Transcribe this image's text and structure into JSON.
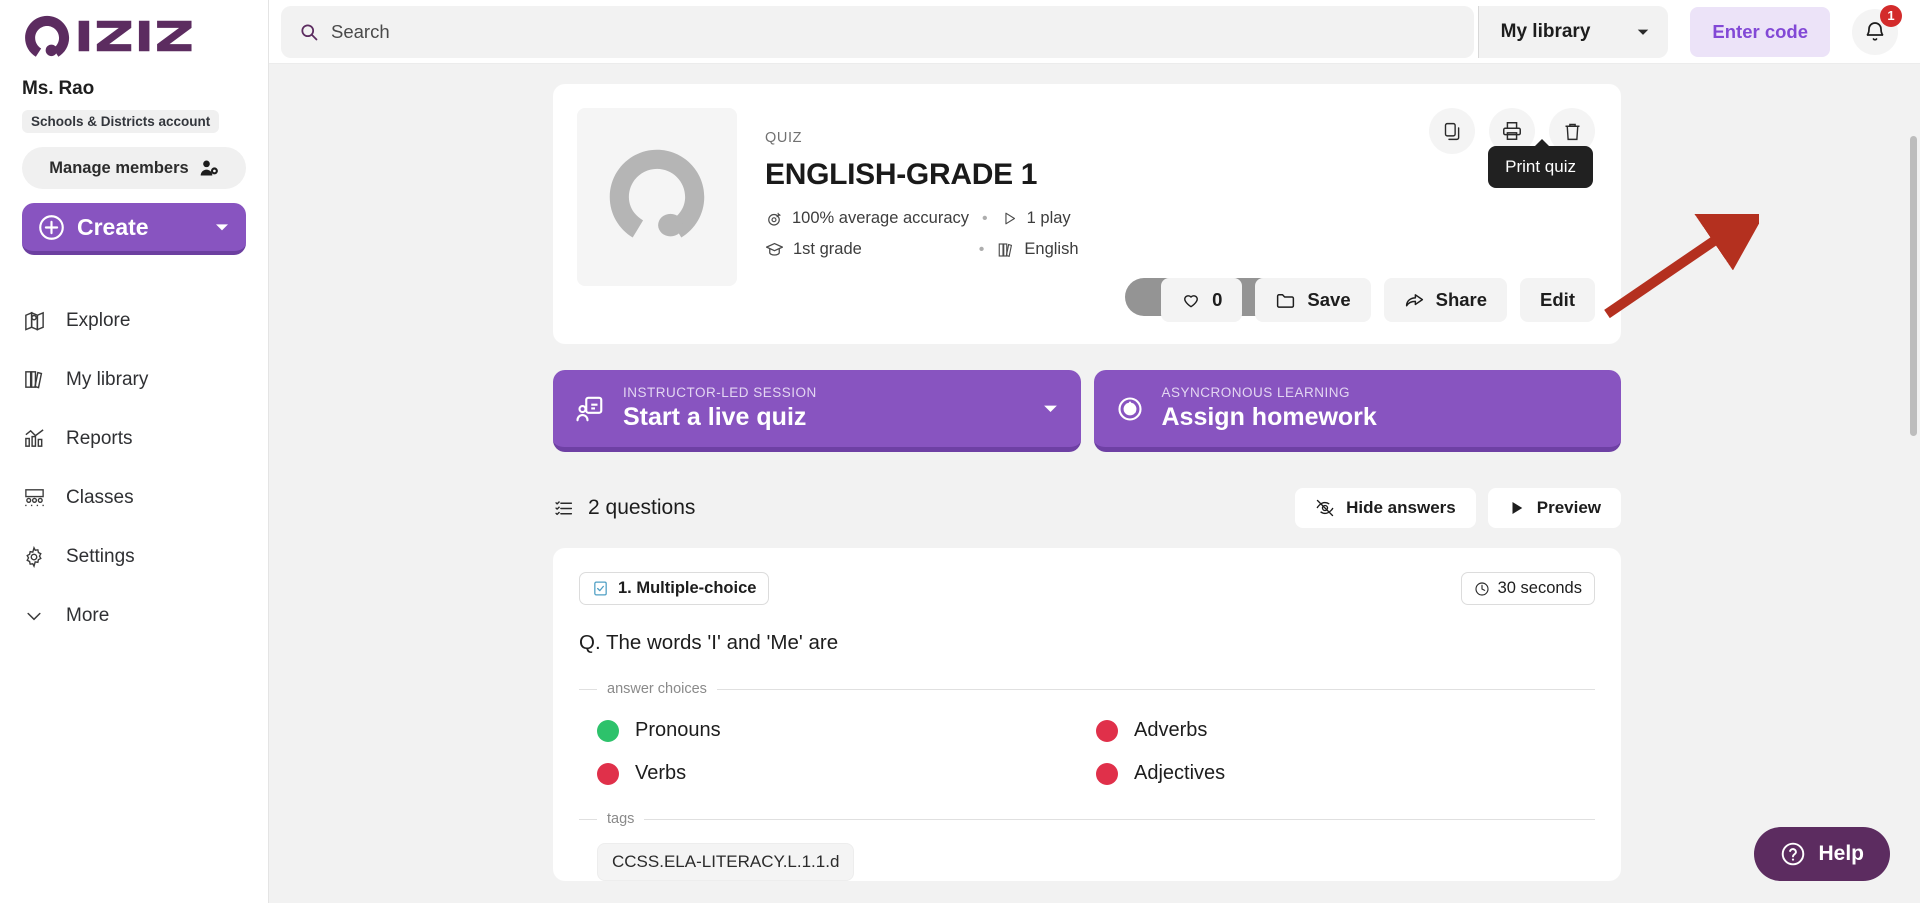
{
  "brand": {
    "name": "Quizizz",
    "purple": "#8854c0",
    "logo_dark": "#5c2c60"
  },
  "sidebar": {
    "user_name": "Ms. Rao",
    "account_badge": "Schools & Districts account",
    "manage_members_label": "Manage members",
    "create_label": "Create",
    "items": [
      {
        "label": "Explore",
        "icon": "compass-map-icon"
      },
      {
        "label": "My library",
        "icon": "books-icon"
      },
      {
        "label": "Reports",
        "icon": "bar-chart-icon"
      },
      {
        "label": "Classes",
        "icon": "people-group-icon"
      },
      {
        "label": "Settings",
        "icon": "gear-icon"
      },
      {
        "label": "More",
        "icon": "chevron-down-icon"
      }
    ]
  },
  "topbar": {
    "search_placeholder": "Search",
    "library_selected": "My library",
    "enter_code_label": "Enter code",
    "notification_count": "1"
  },
  "quiz": {
    "kicker": "QUIZ",
    "title": "ENGLISH-GRADE 1",
    "accuracy": "100% average accuracy",
    "plays": "1 play",
    "grade": "1st grade",
    "subject": "English",
    "separator": "•",
    "actions": [
      {
        "name": "duplicate-quiz-button",
        "icon": "copy-icon"
      },
      {
        "name": "print-quiz-button",
        "icon": "printer-icon"
      },
      {
        "name": "delete-quiz-button",
        "icon": "trash-icon"
      }
    ],
    "tooltip_text": "Print quiz",
    "like_count": "0",
    "save_label": "Save",
    "share_label": "Share",
    "edit_label": "Edit"
  },
  "cta": {
    "live": {
      "sub": "INSTRUCTOR-LED SESSION",
      "main": "Start a live quiz"
    },
    "homework": {
      "sub": "ASYNCRONOUS LEARNING",
      "main": "Assign homework"
    }
  },
  "questions_section": {
    "count_label": "2 questions",
    "hide_answers_label": "Hide answers",
    "preview_label": "Preview"
  },
  "question": {
    "type_label": "1. Multiple-choice",
    "time_label": "30 seconds",
    "text": "Q. The words 'I' and 'Me' are",
    "answer_choices_label": "answer choices",
    "tags_label": "tags",
    "choices": [
      {
        "text": "Pronouns",
        "color": "#2dc26b",
        "correct": true
      },
      {
        "text": "Adverbs",
        "color": "#e0304a",
        "correct": false
      },
      {
        "text": "Verbs",
        "color": "#e0304a",
        "correct": false
      },
      {
        "text": "Adjectives",
        "color": "#e0304a",
        "correct": false
      }
    ],
    "tags": [
      "CCSS.ELA-LITERACY.L.1.1.d"
    ]
  },
  "help": {
    "label": "Help"
  },
  "annotation": {
    "arrow_color": "#b4301f"
  }
}
